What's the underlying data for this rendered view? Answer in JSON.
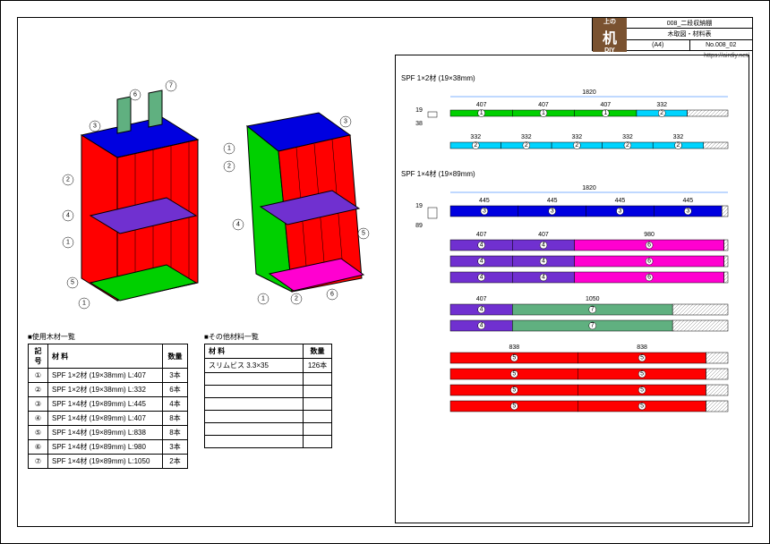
{
  "title_block": {
    "logo_top": "上の",
    "logo_main": "机",
    "logo_bottom": "DIY",
    "project": "008_二段収納棚",
    "drawing": "木取図・材料表",
    "size": "(A4)",
    "number": "No.008_02"
  },
  "url": "https://airdiy.net/",
  "wood_table": {
    "title": "■使用木材一覧",
    "headers": [
      "記号",
      "材 料",
      "数量"
    ],
    "rows": [
      {
        "code": "①",
        "material": "SPF 1×2材 (19×38mm) L:407",
        "qty": "3本"
      },
      {
        "code": "②",
        "material": "SPF 1×2材 (19×38mm) L:332",
        "qty": "6本"
      },
      {
        "code": "③",
        "material": "SPF 1×4材 (19×89mm) L:445",
        "qty": "4本"
      },
      {
        "code": "④",
        "material": "SPF 1×4材 (19×89mm) L:407",
        "qty": "8本"
      },
      {
        "code": "⑤",
        "material": "SPF 1×4材 (19×89mm) L:838",
        "qty": "8本"
      },
      {
        "code": "⑥",
        "material": "SPF 1×4材 (19×89mm) L:980",
        "qty": "3本"
      },
      {
        "code": "⑦",
        "material": "SPF 1×4材 (19×89mm) L:1050",
        "qty": "2本"
      }
    ]
  },
  "other_table": {
    "title": "■その他材料一覧",
    "headers": [
      "材 料",
      "数量"
    ],
    "rows": [
      {
        "material": "スリムビス 3.3×35",
        "qty": "126本"
      },
      {
        "material": "",
        "qty": ""
      },
      {
        "material": "",
        "qty": ""
      },
      {
        "material": "",
        "qty": ""
      },
      {
        "material": "",
        "qty": ""
      },
      {
        "material": "",
        "qty": ""
      },
      {
        "material": "",
        "qty": ""
      }
    ]
  },
  "cut_sections": {
    "s1": {
      "title": "SPF 1×2材 (19×38mm)",
      "total": "1820",
      "thk": "19",
      "wid": "38",
      "board1": {
        "segs": [
          {
            "len": 407,
            "label": "①",
            "color": "#00d000"
          },
          {
            "len": 407,
            "label": "①",
            "color": "#00d000"
          },
          {
            "len": 407,
            "label": "①",
            "color": "#00d000"
          },
          {
            "len": 332,
            "label": "②",
            "color": "#00d4ff"
          }
        ],
        "waste": 267
      },
      "board2": {
        "segs": [
          {
            "len": 332,
            "label": "②",
            "color": "#00d4ff"
          },
          {
            "len": 332,
            "label": "②",
            "color": "#00d4ff"
          },
          {
            "len": 332,
            "label": "②",
            "color": "#00d4ff"
          },
          {
            "len": 332,
            "label": "②",
            "color": "#00d4ff"
          },
          {
            "len": 332,
            "label": "②",
            "color": "#00d4ff"
          }
        ],
        "waste": 160
      }
    },
    "s2": {
      "title": "SPF 1×4材 (19×89mm)",
      "total": "1820",
      "thk": "19",
      "wid": "89",
      "boardsA": {
        "segs": [
          {
            "len": 445,
            "label": "③",
            "color": "#0000e0"
          },
          {
            "len": 445,
            "label": "③",
            "color": "#0000e0"
          },
          {
            "len": 445,
            "label": "③",
            "color": "#0000e0"
          },
          {
            "len": 445,
            "label": "③",
            "color": "#0000e0"
          }
        ],
        "waste": 40,
        "count": 1
      },
      "boardsB": {
        "segs": [
          {
            "len": 407,
            "label": "④",
            "color": "#7030d0"
          },
          {
            "len": 407,
            "label": "④",
            "color": "#7030d0"
          },
          {
            "len": 980,
            "label": "⑥",
            "color": "#ff00d0"
          }
        ],
        "waste": 26,
        "count": 3
      },
      "boardsC": {
        "segs": [
          {
            "len": 407,
            "label": "④",
            "color": "#7030d0"
          },
          {
            "len": 1050,
            "label": "⑦",
            "color": "#60b080"
          }
        ],
        "waste": 363,
        "count": 2
      },
      "boardsD": {
        "segs": [
          {
            "len": 838,
            "label": "⑤",
            "color": "#ff0000"
          },
          {
            "len": 838,
            "label": "⑤",
            "color": "#ff0000"
          }
        ],
        "waste": 144,
        "count": 4
      }
    }
  },
  "iso": {
    "callouts": [
      "①",
      "②",
      "③",
      "④",
      "⑤",
      "⑥",
      "⑦"
    ]
  }
}
